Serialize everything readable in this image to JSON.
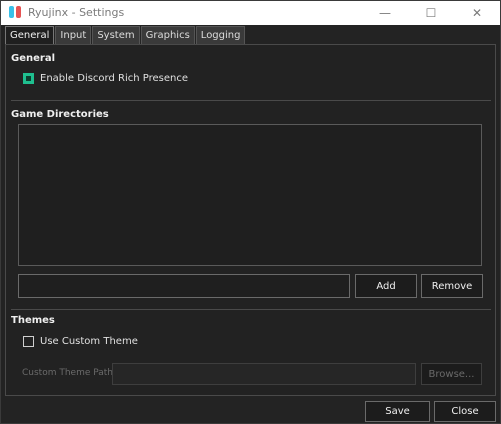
{
  "window": {
    "title": "Ryujinx - Settings",
    "controls": {
      "minimize": "—",
      "maximize": "☐",
      "close": "✕"
    }
  },
  "tabs": [
    {
      "label": "General",
      "active": true
    },
    {
      "label": "Input",
      "active": false
    },
    {
      "label": "System",
      "active": false
    },
    {
      "label": "Graphics",
      "active": false
    },
    {
      "label": "Logging",
      "active": false
    }
  ],
  "general": {
    "title": "General",
    "discord": {
      "label": "Enable Discord Rich Presence",
      "checked": true
    }
  },
  "game_directories": {
    "title": "Game Directories",
    "path_value": "",
    "add_label": "Add",
    "remove_label": "Remove"
  },
  "themes": {
    "title": "Themes",
    "use_custom": {
      "label": "Use Custom Theme",
      "checked": false
    },
    "custom_path_label": "Custom Theme Path:",
    "custom_path_value": "",
    "browse_label": "Browse..."
  },
  "footer": {
    "save_label": "Save",
    "close_label": "Close"
  },
  "colors": {
    "accent": "#1fbf8f"
  }
}
